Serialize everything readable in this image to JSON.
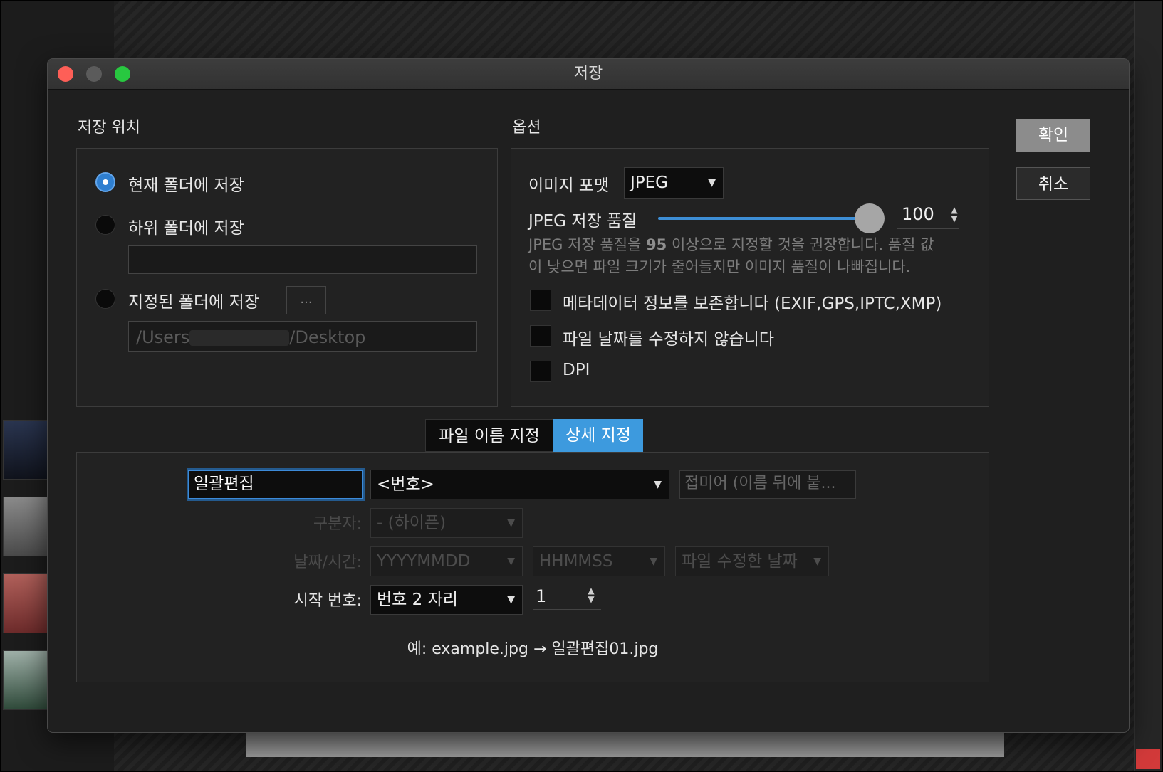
{
  "window": {
    "title": "저장"
  },
  "location": {
    "label": "저장 위치",
    "options": [
      {
        "label": "현재 폴더에 저장",
        "selected": true
      },
      {
        "label": "하위 폴더에 저장",
        "selected": false
      },
      {
        "label": "지정된 폴더에 저장",
        "selected": false
      }
    ],
    "subfolder_value": "",
    "browse_label": "...",
    "folder_path_prefix": "/Users",
    "folder_path_suffix": "/Desktop"
  },
  "options": {
    "label": "옵션",
    "format_label": "이미지 포맷",
    "format_value": "JPEG",
    "quality_label": "JPEG 저장 품질",
    "quality_value": "100",
    "quality_level": 1.0,
    "hint_prefix": "JPEG 저장 품질을 ",
    "hint_bold": "95",
    "hint_suffix": " 이상으로 지정할 것을 권장합니다. 품질 값",
    "hint_line2": "이 낮으면 파일 크기가 줄어들지만 이미지 품질이 나빠집니다.",
    "checkboxes": [
      {
        "label": "메타데이터 정보를 보존합니다 (EXIF,GPS,IPTC,XMP)",
        "checked": false
      },
      {
        "label": "파일 날짜를 수정하지 않습니다",
        "checked": false
      },
      {
        "label": "DPI",
        "checked": false
      }
    ]
  },
  "tabs": [
    {
      "label": "파일 이름 지정",
      "active": false
    },
    {
      "label": "상세 지정",
      "active": true
    }
  ],
  "naming": {
    "prefix_value": "일괄편집",
    "pattern_value": "<번호>",
    "suffix_placeholder": "접미어 (이름 뒤에 붙...",
    "separator_label": "구분자:",
    "separator_value": "- (하이픈)",
    "datetime_label": "날짜/시간:",
    "date_value": "YYYYMMDD",
    "time_value": "HHMMSS",
    "date_source_value": "파일 수정한 날짜",
    "start_label": "시작 번호:",
    "digits_value": "번호 2 자리",
    "start_value": "1",
    "example": "예: example.jpg → 일괄편집01.jpg"
  },
  "buttons": {
    "ok": "확인",
    "cancel": "취소"
  },
  "colors": {
    "accent": "#3d9ade",
    "close": "#fe5f57",
    "zoom": "#28c840"
  }
}
